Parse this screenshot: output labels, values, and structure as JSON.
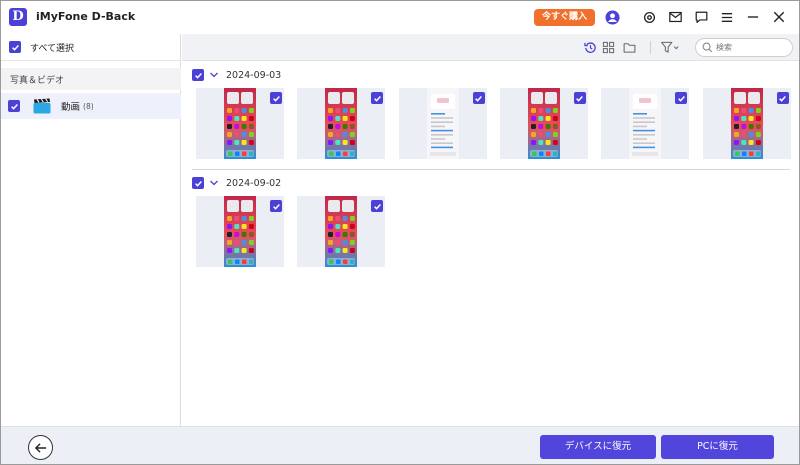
{
  "app": {
    "title": "iMyFone D-Back",
    "logo_letter": "D",
    "buy_label": "今すぐ購入"
  },
  "titlebar_icons": [
    "account-icon",
    "settings-icon",
    "mail-icon",
    "feedback-icon",
    "menu-icon",
    "minimize-icon",
    "close-icon"
  ],
  "sidebar": {
    "select_all_label": "すべて選択",
    "category_label": "写真＆ビデオ",
    "items": [
      {
        "label": "動画",
        "count": "(8)",
        "checked": true
      }
    ]
  },
  "toolbar": {
    "icons": [
      "history-icon",
      "grid-view-icon",
      "folder-icon",
      "filter-icon"
    ],
    "search_placeholder": "検索"
  },
  "groups": [
    {
      "date": "2024-09-03",
      "items": [
        "home-screen",
        "home-screen",
        "settings-screen",
        "home-screen",
        "settings-screen",
        "home-screen"
      ]
    },
    {
      "date": "2024-09-02",
      "items": [
        "home-screen",
        "home-screen"
      ]
    }
  ],
  "footer": {
    "recover_device_label": "デバイスに復元",
    "recover_pc_label": "PCに復元"
  },
  "colors": {
    "accent": "#4b41d6",
    "buy": "#f0702c",
    "button": "#5145dc"
  }
}
